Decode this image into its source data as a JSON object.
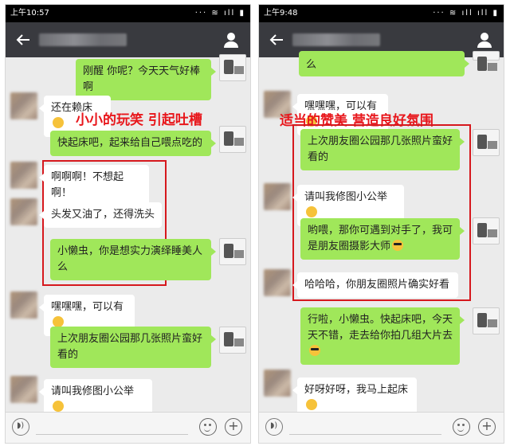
{
  "left": {
    "status_time": "上午10:57",
    "status_icons": "··· ≋ ıll ▮",
    "caption": "小小的玩笑 引起吐槽",
    "messages": [
      {
        "side": "out",
        "text": "刚醒 你呢？今天天气好棒啊",
        "emoji": ""
      },
      {
        "side": "in",
        "text": "还在赖床",
        "emoji": "smile"
      },
      {
        "side": "out",
        "text": "快起床吧，起来给自己喂点吃的",
        "emoji": ""
      },
      {
        "side": "in",
        "text": "啊啊啊！不想起啊！",
        "emoji": ""
      },
      {
        "side": "in",
        "text": "头发又油了，还得洗头",
        "emoji": ""
      },
      {
        "side": "out",
        "text": "小懒虫，你是想实力演绎睡美人么",
        "emoji": ""
      },
      {
        "side": "in",
        "text": "嘿嘿嘿，可以有",
        "emoji": "smile"
      },
      {
        "side": "out",
        "text": "上次朋友圈公园那几张照片蛮好看的",
        "emoji": ""
      },
      {
        "side": "in",
        "text": "请叫我修图小公举",
        "emoji": "shy"
      }
    ]
  },
  "right": {
    "status_time": "上午9:48",
    "status_icons": "··· ≋ ıll ıll ▮",
    "caption": "适当的赞美 营造良好氛围",
    "messages": [
      {
        "side": "out",
        "text": "么",
        "emoji": ""
      },
      {
        "side": "in",
        "text": "嘿嘿嘿，可以有",
        "emoji": "smile"
      },
      {
        "side": "out",
        "text": "上次朋友圈公园那几张照片蛮好看的",
        "emoji": ""
      },
      {
        "side": "in",
        "text": "请叫我修图小公举",
        "emoji": "shy"
      },
      {
        "side": "out",
        "text": "哟喂，那你可遇到对手了，我可是朋友圈摄影大师",
        "emoji": "cool"
      },
      {
        "side": "in",
        "text": "哈哈哈，你朋友圈照片确实好看",
        "emoji": ""
      },
      {
        "side": "out",
        "text": "行啦，小懒虫。快起床吧，今天天不错，走去给你拍几组大片去",
        "emoji": "cool"
      },
      {
        "side": "in",
        "text": "好呀好呀，我马上起床",
        "emoji": "smile"
      }
    ]
  },
  "colors": {
    "nav_bg": "#393a3f",
    "chat_bg": "#ebebeb",
    "out_bubble": "#a0e75a",
    "in_bubble": "#ffffff",
    "caption_red": "#e8161b"
  },
  "icons": {
    "back": "arrow-left-icon",
    "contact": "person-icon",
    "voice": "voice-icon",
    "emoji": "emoji-icon",
    "plus": "plus-icon"
  }
}
